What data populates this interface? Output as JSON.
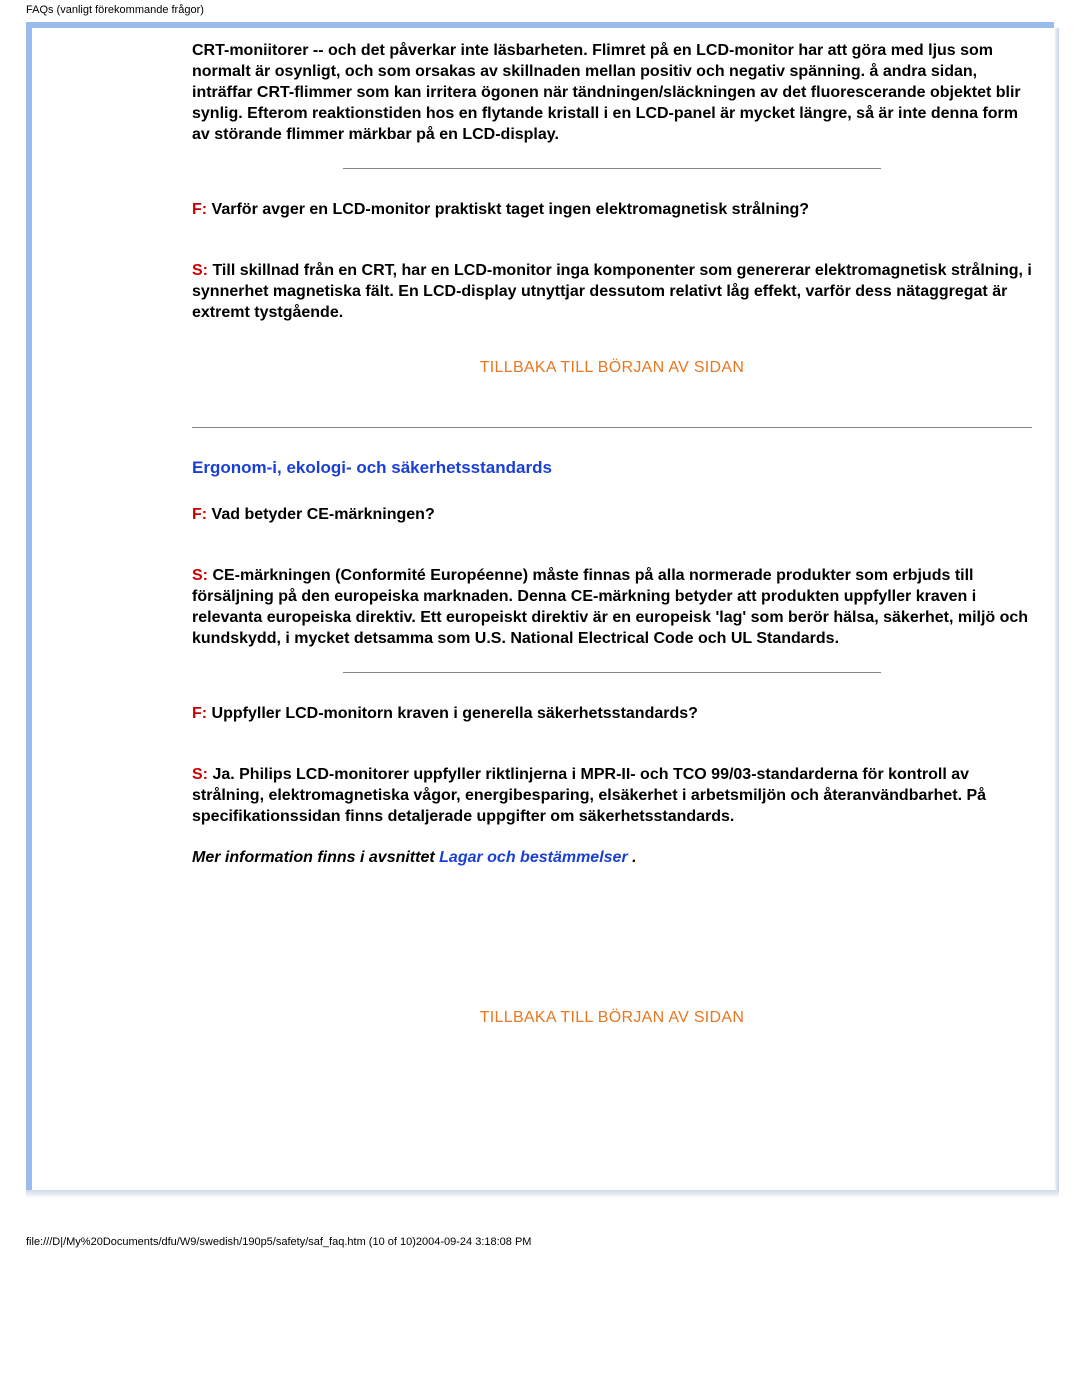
{
  "header": {
    "title": "FAQs (vanligt förekommande frågor)"
  },
  "content": {
    "intro_fragment": "CRT-moniitorer -- och det påverkar inte läsbarheten. Flimret på en LCD-monitor har att göra med ljus som normalt är osynligt, och som orsakas av skillnaden mellan positiv och negativ spänning. å andra sidan, inträffar CRT-flimmer som kan irritera ögonen när tändningen/släckningen av det fluorescerande objektet blir synlig. Efterom reaktionstiden hos en flytande kristall i en LCD-panel är mycket längre, så är inte denna form av störande flimmer märkbar på en LCD-display.",
    "qa1": {
      "f_label": "F:",
      "f_text": " Varför avger en LCD-monitor praktiskt taget ingen elektromagnetisk strålning?",
      "s_label": "S:",
      "s_text": " Till skillnad från en CRT, har en LCD-monitor inga komponenter som genererar elektromagnetisk strålning, i synnerhet magnetiska fält. En LCD-display utnyttjar dessutom relativt låg effekt, varför dess nätaggregat är extremt tystgående."
    },
    "back_link_1": "TILLBAKA TILL BÖRJAN AV SIDAN",
    "section_heading": "Ergonom-i, ekologi- och säkerhetsstandards",
    "qa2": {
      "f_label": "F:",
      "f_text": " Vad betyder CE-märkningen?",
      "s_label": "S:",
      "s_text": " CE-märkningen (Conformité Européenne) måste finnas på alla normerade produkter som erbjuds till försäljning på den europeiska marknaden. Denna CE-märkning betyder att produkten uppfyller kraven i relevanta europeiska direktiv. Ett europeiskt direktiv är en europeisk 'lag' som berör hälsa, säkerhet, miljö och kundskydd, i mycket detsamma som U.S. National Electrical Code och UL Standards."
    },
    "qa3": {
      "f_label": "F:",
      "f_text": " Uppfyller LCD-monitorn kraven i generella säkerhetsstandards?",
      "s_label": "S:",
      "s_text": " Ja. Philips LCD-monitorer uppfyller riktlinjerna i MPR-II- och TCO 99/03-standarderna för kontroll av strålning, elektromagnetiska vågor, energibesparing, elsäkerhet i arbetsmiljön och återanvändbarhet. På specifikationssidan finns detaljerade uppgifter om säkerhetsstandards."
    },
    "more_info_prefix": "Mer information finns i avsnittet ",
    "more_info_link": "Lagar och bestämmelser",
    "more_info_suffix": " .",
    "back_link_2": "TILLBAKA TILL BÖRJAN AV SIDAN"
  },
  "footer": {
    "path": "file:///D|/My%20Documents/dfu/W9/swedish/190p5/safety/saf_faq.htm (10 of 10)2004-09-24 3:18:08 PM"
  }
}
